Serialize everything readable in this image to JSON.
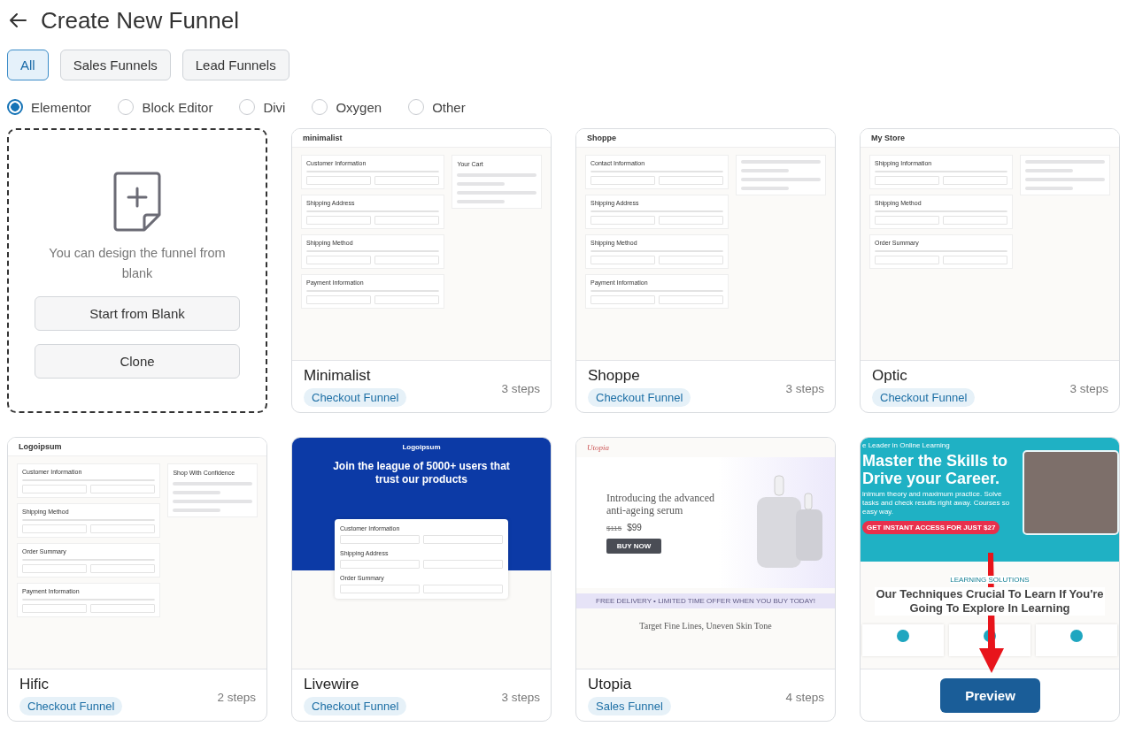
{
  "header": {
    "title": "Create New Funnel"
  },
  "filters": [
    {
      "label": "All",
      "selected": true
    },
    {
      "label": "Sales Funnels",
      "selected": false
    },
    {
      "label": "Lead Funnels",
      "selected": false
    }
  ],
  "builders": [
    {
      "label": "Elementor",
      "selected": true
    },
    {
      "label": "Block Editor",
      "selected": false
    },
    {
      "label": "Divi",
      "selected": false
    },
    {
      "label": "Oxygen",
      "selected": false
    },
    {
      "label": "Other",
      "selected": false
    }
  ],
  "blank_card": {
    "text": "You can design the funnel from blank",
    "buttons": [
      "Start from Blank",
      "Clone"
    ]
  },
  "templates": [
    {
      "name": "Minimalist",
      "tag": "Checkout Funnel",
      "steps": "3 steps",
      "preview": {
        "kind": "checkout",
        "logo": "minimalist",
        "sections": [
          "Customer Information",
          "Shipping Address",
          "Shipping Method",
          "Payment Information"
        ],
        "side_title": "Your Cart"
      }
    },
    {
      "name": "Shoppe",
      "tag": "Checkout Funnel",
      "steps": "3 steps",
      "preview": {
        "kind": "checkout",
        "logo": "Shoppe",
        "sections": [
          "Contact Information",
          "Shipping Address",
          "Shipping Method",
          "Payment Information"
        ]
      }
    },
    {
      "name": "Optic",
      "tag": "Checkout Funnel",
      "steps": "3 steps",
      "preview": {
        "kind": "checkout",
        "logo": "My Store",
        "sections": [
          "Shipping Information",
          "Shipping Method",
          "Order Summary"
        ]
      }
    },
    {
      "name": "Hific",
      "tag": "Checkout Funnel",
      "steps": "2 steps",
      "preview": {
        "kind": "checkout",
        "logo": "Logoipsum",
        "sections": [
          "Customer Information",
          "Shipping Method",
          "Order Summary",
          "Payment Information"
        ],
        "side_title": "Shop With Confidence"
      }
    },
    {
      "name": "Livewire",
      "tag": "Checkout Funnel",
      "steps": "3 steps",
      "preview": {
        "kind": "hero-form",
        "logo": "Logoipsum",
        "headline": "Join the league of 5000+ users that trust our products",
        "sections": [
          "Customer Information",
          "Shipping Address",
          "Order Summary"
        ]
      }
    },
    {
      "name": "Utopia",
      "tag": "Sales Funnel",
      "steps": "4 steps",
      "preview": {
        "kind": "product",
        "logo": "Utopia",
        "headline": "Introducing the advanced anti-ageing serum",
        "price_old": "$115",
        "price": "$99",
        "cta": "BUY NOW",
        "banner": "FREE DELIVERY • LIMITED TIME OFFER WHEN YOU BUY TODAY!",
        "subheadline": "Target Fine Lines, Uneven Skin Tone"
      }
    },
    {
      "action": "Preview",
      "pointer_arrow": true,
      "preview": {
        "kind": "course",
        "eyebrow": "e Leader in Online Learning",
        "headline": "Master the Skills to Drive your Career.",
        "body": "inimum theory and maximum practice. Solve tasks and check results right away. Courses so easy way.",
        "cta": "GET INSTANT ACCESS FOR JUST $27",
        "label": "LEARNING SOLUTIONS",
        "subheadline": "Our Techniques Crucial To Learn If You're Going To Explore In Learning"
      }
    }
  ]
}
